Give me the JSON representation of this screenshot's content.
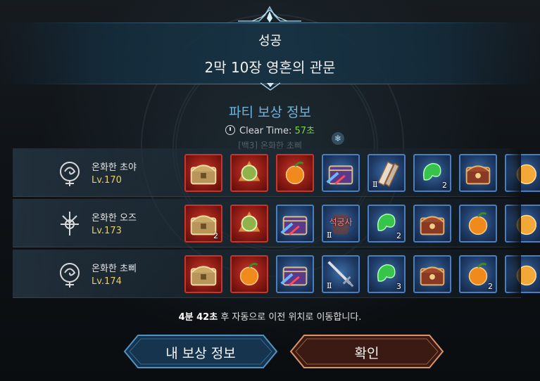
{
  "header": {
    "status": "성공",
    "stage": "2막 10장 영혼의 관문"
  },
  "party": {
    "title": "파티 보상 정보",
    "clear_label": "Clear Time:",
    "clear_value": "57초",
    "ghost_text": "[백3] 온화한 초삐"
  },
  "members": [
    {
      "name": "온화한 초야",
      "level": "Lv.170",
      "items": [
        {
          "icon": "gold-chest-icon",
          "frame": "red",
          "count": "",
          "tier": ""
        },
        {
          "icon": "green-orb-icon",
          "frame": "red",
          "count": "",
          "tier": ""
        },
        {
          "icon": "orange-fruit-icon",
          "frame": "red",
          "count": "",
          "tier": ""
        },
        {
          "icon": "purple-chest-icon",
          "frame": "blue",
          "count": "",
          "tier": ""
        },
        {
          "icon": "scroll-icon",
          "frame": "blue",
          "count": "",
          "tier": "Ⅱ"
        },
        {
          "icon": "green-jade-icon",
          "frame": "blue",
          "count": "2",
          "tier": ""
        },
        {
          "icon": "red-chest-icon",
          "frame": "blue",
          "count": "",
          "tier": ""
        },
        {
          "icon": "gold-fruit-icon",
          "frame": "blue",
          "count": "",
          "tier": ""
        }
      ]
    },
    {
      "name": "온화한 오즈",
      "level": "Lv.173",
      "items": [
        {
          "icon": "gold-chest-icon",
          "frame": "red",
          "count": "2",
          "tier": ""
        },
        {
          "icon": "green-orb-icon",
          "frame": "red",
          "count": "",
          "tier": ""
        },
        {
          "icon": "purple-chest-icon",
          "frame": "blue",
          "count": "",
          "tier": ""
        },
        {
          "icon": "stone-craft-icon",
          "frame": "blue",
          "count": "",
          "tier": "Ⅱ",
          "text": "석궁사"
        },
        {
          "icon": "green-jade-icon",
          "frame": "blue",
          "count": "2",
          "tier": ""
        },
        {
          "icon": "red-chest-icon",
          "frame": "blue",
          "count": "",
          "tier": ""
        },
        {
          "icon": "orange-fruit-icon",
          "frame": "blue",
          "count": "",
          "tier": ""
        },
        {
          "icon": "gold-fruit-icon",
          "frame": "blue",
          "count": "",
          "tier": ""
        }
      ]
    },
    {
      "name": "온화한 초삐",
      "level": "Lv.174",
      "items": [
        {
          "icon": "gold-chest-icon",
          "frame": "red",
          "count": "",
          "tier": ""
        },
        {
          "icon": "orange-fruit-icon",
          "frame": "red",
          "count": "",
          "tier": ""
        },
        {
          "icon": "purple-chest-icon",
          "frame": "blue",
          "count": "",
          "tier": ""
        },
        {
          "icon": "sword-icon",
          "frame": "blue",
          "count": "",
          "tier": "Ⅱ"
        },
        {
          "icon": "green-jade-icon",
          "frame": "blue",
          "count": "3",
          "tier": ""
        },
        {
          "icon": "red-chest-icon",
          "frame": "blue",
          "count": "",
          "tier": ""
        },
        {
          "icon": "orange-fruit-icon",
          "frame": "blue",
          "count": "2",
          "tier": ""
        },
        {
          "icon": "gold-fruit-icon",
          "frame": "blue",
          "count": "",
          "tier": ""
        }
      ]
    }
  ],
  "notice": {
    "time": "4분 42초",
    "text": "후 자동으로 이전 위치로 이동합니다."
  },
  "buttons": {
    "my_reward": "내 보상 정보",
    "confirm": "확인"
  },
  "colors": {
    "accent_blue": "#6fb3dc",
    "level_gold": "#e7cf6a",
    "clear_green": "#7fd34e",
    "red_frame": "#c7362a",
    "blue_frame": "#4a7fbf"
  }
}
